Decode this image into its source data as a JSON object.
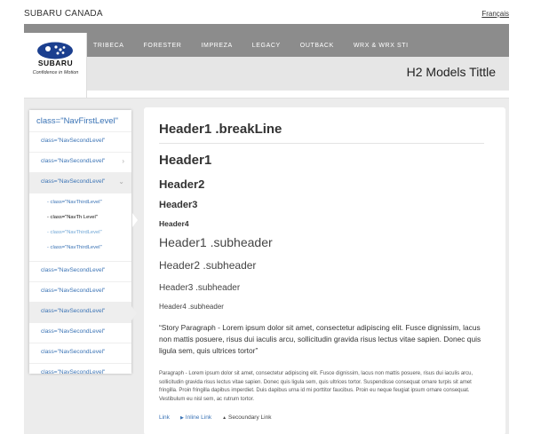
{
  "brand": "SUBARU CANADA",
  "language_link": "Français",
  "logo": {
    "wordmark": "SUBARU",
    "tagline": "Confidence in Motion"
  },
  "models": [
    "TRIBECA",
    "FORESTER",
    "IMPREZA",
    "LEGACY",
    "OUTBACK",
    "WRX & WRX STI"
  ],
  "page_title": "H2 Models Tittle",
  "sidenav": {
    "first_level": "class=\"NavFirstLevel\"",
    "items_top": [
      "class=\"NavSecondLevel\"",
      "class=\"NavSecondLevel\"",
      "class=\"NavSecondLevel\""
    ],
    "third_level": [
      "- class=\"NavThirdLevel\"",
      "- class=\"NavTh     Level\"",
      "- class=\"NavThirdLevel\"",
      "- class=\"NavThirdLevel\""
    ],
    "items_bottom": [
      "class=\"NavSecondLevel\"",
      "class=\"NavSecondLevel\"",
      "class=\"NavSecondLevel\"",
      "class=\"NavSecondLevel\"",
      "class=\"NavSecondLevel\"",
      "class=\"NavSecondLevel\""
    ]
  },
  "content": {
    "breakline": "Header1  .breakLine",
    "h1": "Header1",
    "h2": "Header2",
    "h3": "Header3",
    "h4": "Header4",
    "sub1": "Header1 .subheader",
    "sub2": "Header2 .subheader",
    "sub3": "Header3 .subheader",
    "sub4": "Header4 .subheader",
    "story": "“Story Paragraph - Lorem ipsum dolor sit amet, consectetur adipiscing elit. Fusce dignissim, lacus non mattis posuere, risus dui iaculis arcu, sollicitudin gravida risus lectus vitae sapien. Donec quis ligula sem, quis ultrices tortor”",
    "paragraph": "Paragraph - Lorem ipsum dolor sit amet, consectetur adipiscing elit. Fusce dignissim, lacus non mattis posuere, risus dui iaculis arcu, sollicitudin gravida risus lectus vitae sapien. Donec quis ligula sem, quis ultrices tortor. Suspendisse consequat ornare turpis sit amet fringilla. Proin fringilla dapibus imperdiet. Duis dapibus urna id mi porttitor faucibus. Proin eu neque feugiat ipsum ornare consequat. Vestibulum eu nisl sem, ac rutrum tortor.",
    "link": "Link",
    "inline_link": "Inline Link",
    "secondary_link": "Secoundary Link"
  }
}
